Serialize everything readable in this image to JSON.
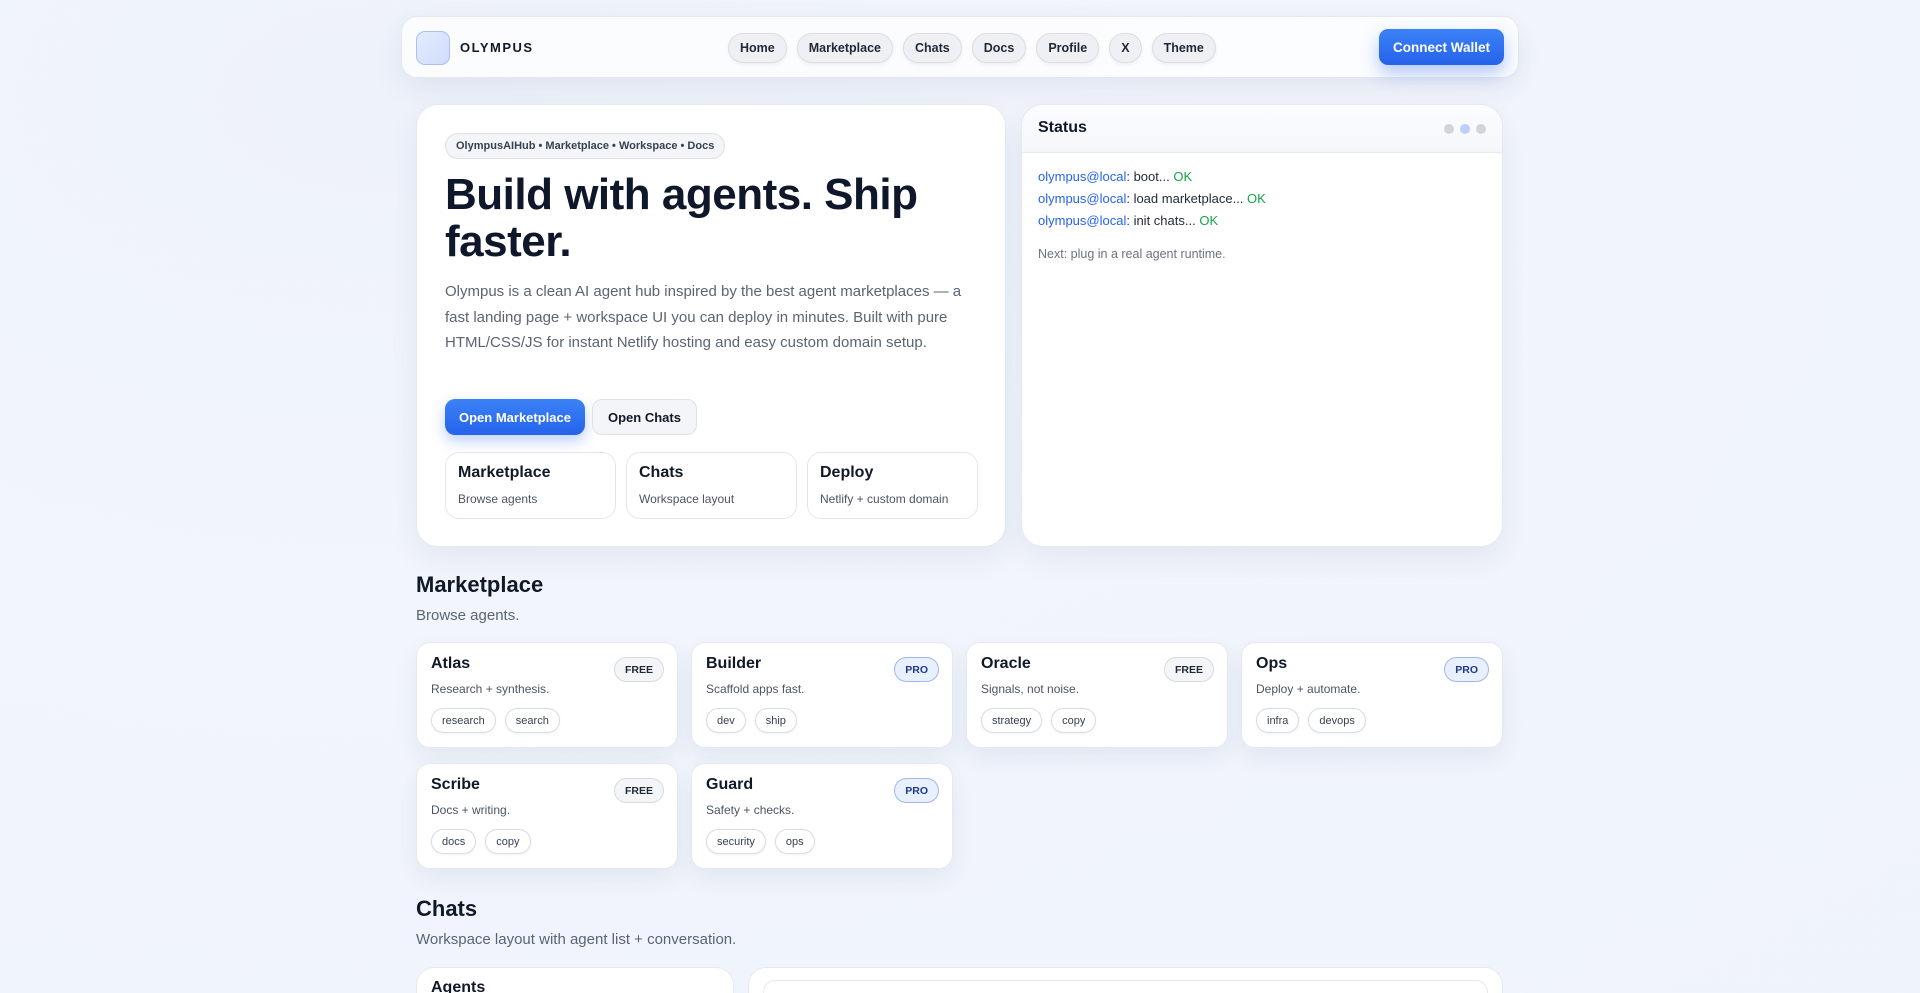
{
  "brand": {
    "name": "OLYMPUS"
  },
  "nav": {
    "links": [
      {
        "label": "Home"
      },
      {
        "label": "Marketplace"
      },
      {
        "label": "Chats"
      },
      {
        "label": "Docs"
      },
      {
        "label": "Profile"
      },
      {
        "label": "X"
      },
      {
        "label": "Theme"
      }
    ],
    "connect_label": "Connect Wallet"
  },
  "hero": {
    "tag": "OlympusAIHub • Marketplace • Workspace • Docs",
    "title": "Build with agents. Ship faster.",
    "description": "Olympus is a clean AI agent hub inspired by the best agent marketplaces — a fast landing page + workspace UI you can deploy in minutes. Built with pure HTML/CSS/JS for instant Netlify hosting and easy custom domain setup.",
    "primary_label": "Open Marketplace",
    "secondary_label": "Open Chats",
    "features": [
      {
        "title": "Marketplace",
        "sub": "Browse agents"
      },
      {
        "title": "Chats",
        "sub": "Workspace layout"
      },
      {
        "title": "Deploy",
        "sub": "Netlify + custom domain"
      }
    ]
  },
  "status": {
    "title": "Status",
    "logs": [
      {
        "who": "olympus@local",
        "msg": ": boot... ",
        "result": "OK"
      },
      {
        "who": "olympus@local",
        "msg": ": load marketplace... ",
        "result": "OK"
      },
      {
        "who": "olympus@local",
        "msg": ": init chats... ",
        "result": "OK"
      }
    ],
    "note": "Next: plug in a real agent runtime."
  },
  "marketplace": {
    "title": "Marketplace",
    "subtitle": "Browse agents.",
    "agents": [
      {
        "name": "Atlas",
        "desc": "Research + synthesis.",
        "tier": "FREE",
        "tags": [
          "research",
          "search"
        ]
      },
      {
        "name": "Builder",
        "desc": "Scaffold apps fast.",
        "tier": "PRO",
        "tags": [
          "dev",
          "ship"
        ]
      },
      {
        "name": "Oracle",
        "desc": "Signals, not noise.",
        "tier": "FREE",
        "tags": [
          "strategy",
          "copy"
        ]
      },
      {
        "name": "Ops",
        "desc": "Deploy + automate.",
        "tier": "PRO",
        "tags": [
          "infra",
          "devops"
        ]
      },
      {
        "name": "Scribe",
        "desc": "Docs + writing.",
        "tier": "FREE",
        "tags": [
          "docs",
          "copy"
        ]
      },
      {
        "name": "Guard",
        "desc": "Safety + checks.",
        "tier": "PRO",
        "tags": [
          "security",
          "ops"
        ]
      }
    ]
  },
  "chats": {
    "title": "Chats",
    "subtitle": "Workspace layout with agent list + conversation.",
    "agents_title": "Agents"
  },
  "colors": {
    "accent": "#2563eb",
    "ok": "#16a34a",
    "text": "#0f172a"
  }
}
